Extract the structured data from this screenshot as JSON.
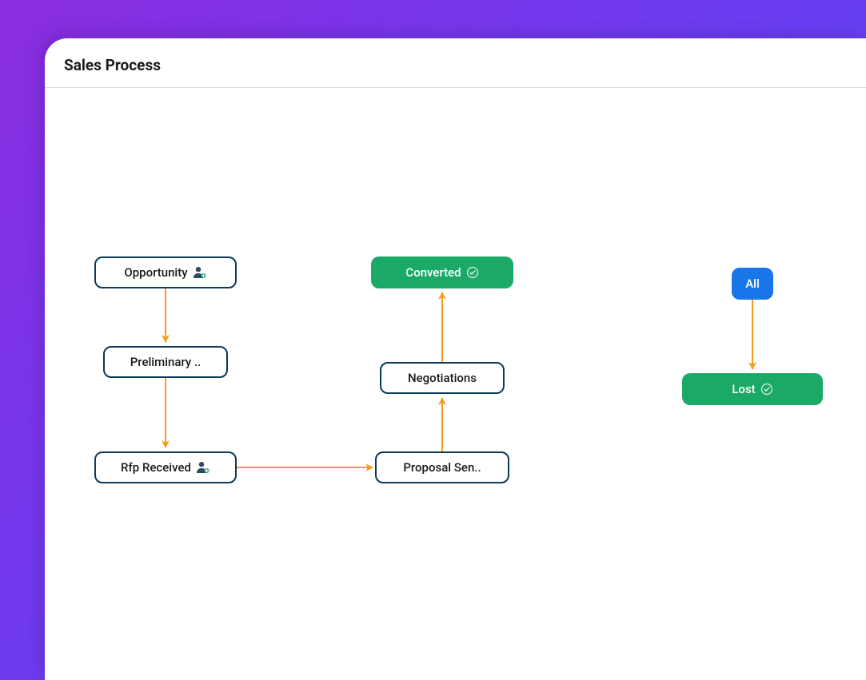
{
  "header": {
    "title": "Sales Process"
  },
  "nodes": {
    "opportunity": "Opportunity",
    "preliminary": "Preliminary ..",
    "rfp": "Rfp Received",
    "proposal": "Proposal Sen..",
    "negotiations": "Negotiations",
    "converted": "Converted",
    "all": "All",
    "lost": "Lost"
  },
  "colors": {
    "arrow": "#f39c1f",
    "outlineBorder": "#0a3a5c",
    "green": "#1ba968",
    "blue": "#1976e8"
  }
}
